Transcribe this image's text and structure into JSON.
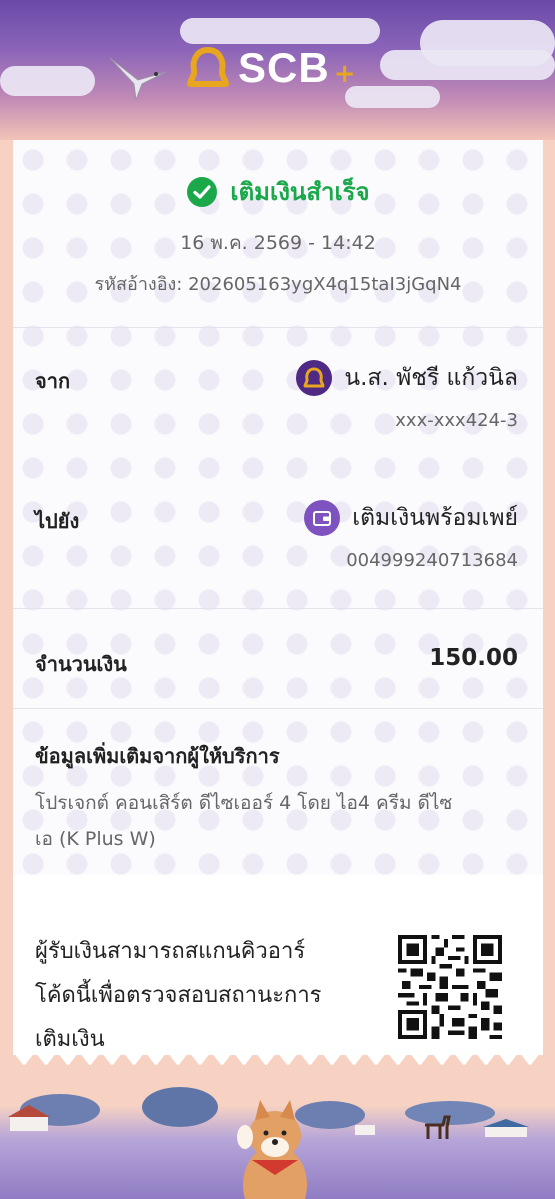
{
  "header": {
    "brand": "SCB",
    "brand_plus": "+",
    "logo_icon": "scb-bell-logo-icon",
    "bird_icon": "bird-icon"
  },
  "receipt": {
    "status": "เติมเงินสำเร็จ",
    "status_icon": "check-circle-icon",
    "status_color": "#1aa84b",
    "datetime": "16 พ.ค. 2569 - 14:42",
    "reference": "รหัสอ้างอิง: 202605163ygX4q15taI3jGqN4",
    "from": {
      "label": "จาก",
      "name": "น.ส. พัชรี แก้วนิล",
      "account": "xxx-xxx424-3",
      "icon": "scb-bank-icon"
    },
    "to": {
      "label": "ไปยัง",
      "name": "เติมเงินพร้อมเพย์",
      "account": "004999240713684",
      "icon": "wallet-icon"
    },
    "amount": {
      "label": "จำนวนเงิน",
      "value": "150.00"
    },
    "provider_info": {
      "title": "ข้อมูลเพิ่มเติมจากผู้ให้บริการ",
      "line1": "โปรเจกต์ คอนเสิร์ต ดีไซเออร์ 4 โดย ไอ4 ครีม ดีไซ",
      "line2": "เอ (K Plus W)"
    },
    "qr": {
      "line1": "ผู้รับเงินสามารถสแกนคิวอาร์",
      "line2": "โค้ดนี้เพื่อตรวจสอบสถานะการ",
      "line3": "เติมเงิน",
      "icon": "qr-code-icon"
    }
  },
  "colors": {
    "brand_purple": "#4e2a84",
    "brand_gold": "#e8a51f",
    "success_green": "#1aa84b"
  }
}
